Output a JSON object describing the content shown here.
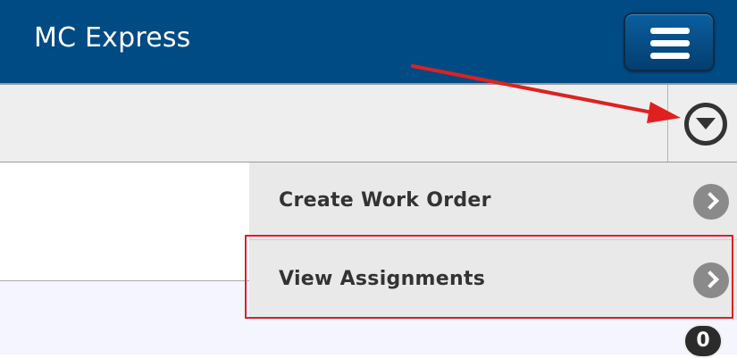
{
  "header": {
    "title": "MC Express",
    "menu_icon": "hamburger-icon"
  },
  "toolbar": {
    "dropdown_icon": "chevron-down-circle-icon"
  },
  "dropdown": {
    "items": [
      {
        "label": "Create Work Order",
        "icon": "chevron-right-circle-icon"
      },
      {
        "label": "View Assignments",
        "icon": "chevron-right-circle-icon"
      }
    ]
  },
  "badge": {
    "count": "0"
  },
  "colors": {
    "header_bg": "#004b84",
    "annotation_red": "#e02020",
    "dropdown_bg": "#e9e9e9"
  }
}
